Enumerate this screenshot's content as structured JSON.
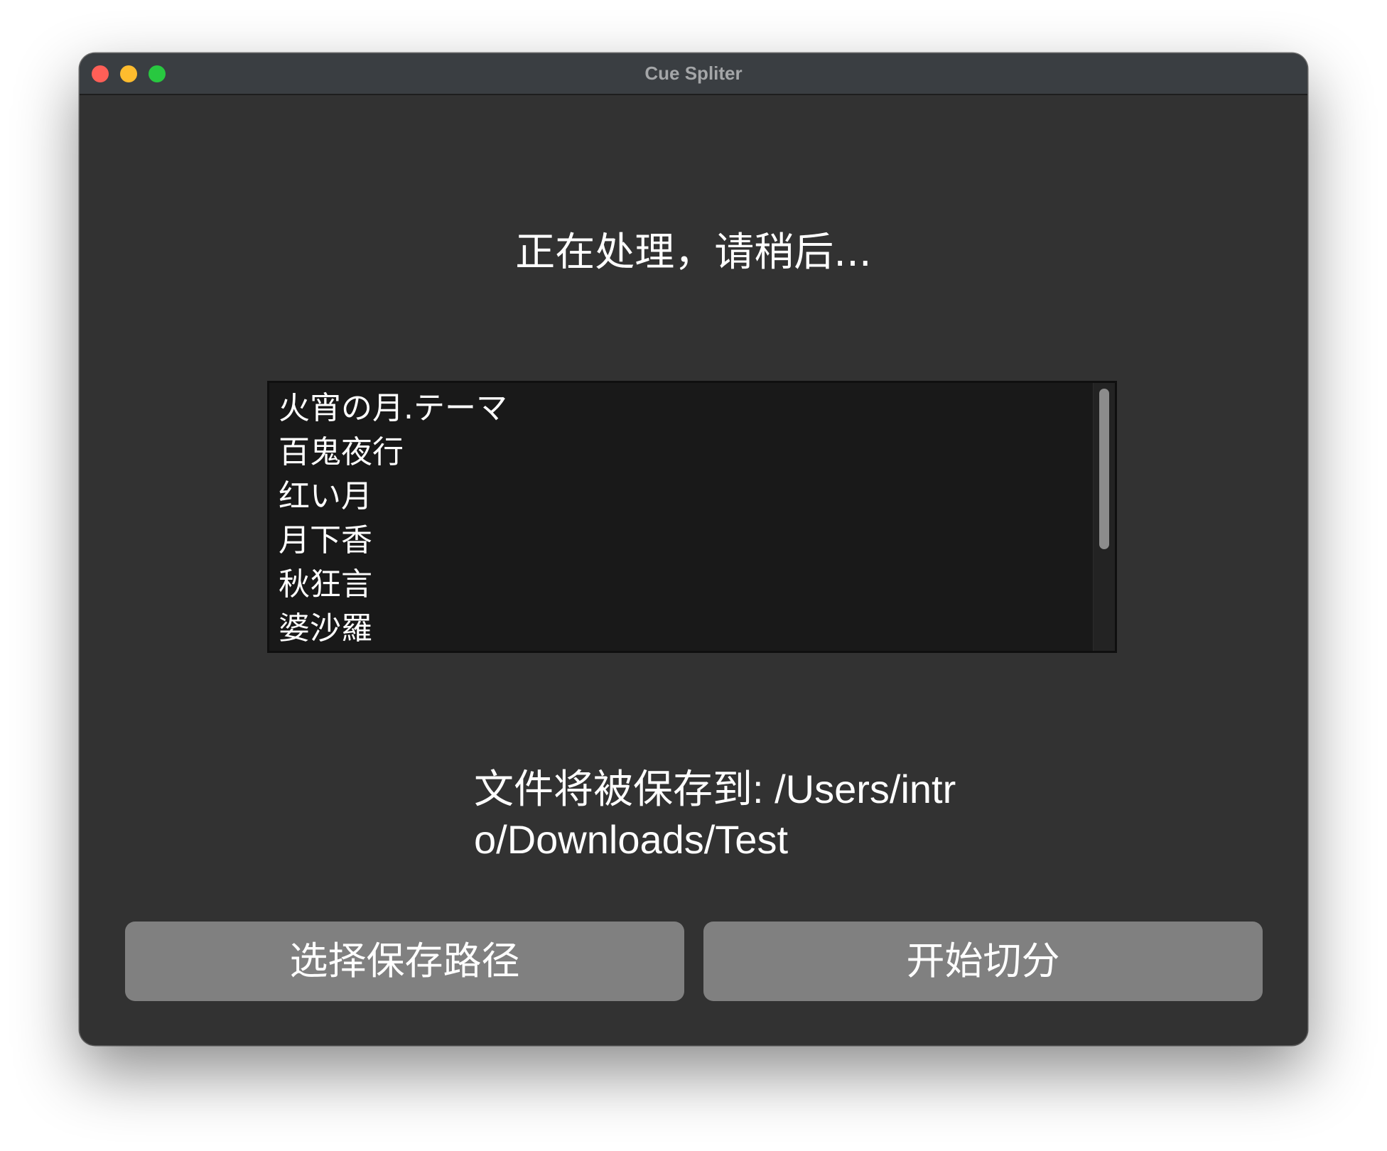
{
  "window": {
    "title": "Cue Spliter"
  },
  "status_text": "正在处理，请稍后...",
  "tracks": [
    "火宵の月.テーマ",
    "百鬼夜行",
    "红い月",
    "月下香",
    "秋狂言",
    "婆沙羅"
  ],
  "save_path_text": "文件将被保存到: /Users/intro/Downloads/Test",
  "buttons": {
    "choose_path": "选择保存路径",
    "start_split": "开始切分"
  },
  "colors": {
    "window_bg": "#323232",
    "titlebar_bg": "#3a3e42",
    "list_bg": "#191919",
    "button_bg": "#808080",
    "close": "#ff5f57",
    "minimize": "#febc2e",
    "zoom": "#28c840"
  }
}
